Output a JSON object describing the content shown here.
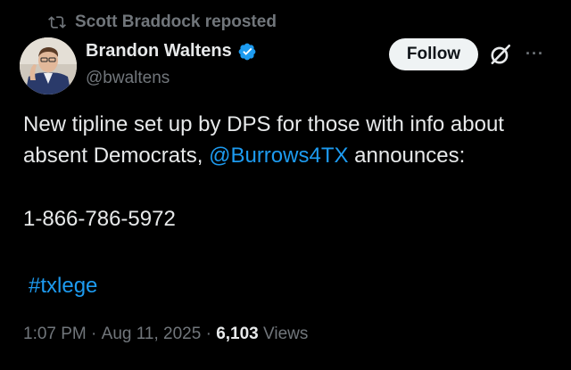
{
  "repost": {
    "text": "Scott Braddock reposted"
  },
  "author": {
    "display_name": "Brandon Waltens",
    "handle": "@bwaltens"
  },
  "actions": {
    "follow_label": "Follow",
    "more_label": "···"
  },
  "tweet": {
    "line1": "New tipline set up by DPS for those with info about",
    "line2_prefix": "absent Democrats, ",
    "mention": "@Burrows4TX",
    "line2_suffix": " announces:",
    "phone": "1-866-786-5972",
    "hashtag": "#txlege"
  },
  "meta": {
    "time": "1:07 PM",
    "sep1": " · ",
    "date": "Aug 11, 2025",
    "sep2": " · ",
    "views_count": "6,103",
    "views_label": " Views"
  },
  "colors": {
    "background": "#000000",
    "link": "#1d9bf0",
    "muted": "#71767b",
    "text": "#e7e9ea",
    "verified": "#1d9bf0"
  },
  "icons": [
    "repost-icon",
    "verified-badge-icon",
    "grok-icon",
    "more-icon"
  ]
}
